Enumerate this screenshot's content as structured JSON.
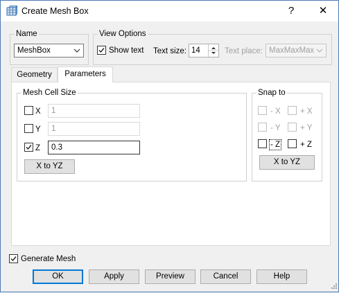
{
  "window": {
    "title": "Create Mesh Box",
    "help_label": "?",
    "close_label": "✕"
  },
  "name_group": {
    "title": "Name",
    "selected": "MeshBox"
  },
  "view_options": {
    "title": "View Options",
    "show_text_label": "Show text",
    "show_text_checked": true,
    "text_size_label": "Text size:",
    "text_size_value": "14",
    "text_place_label": "Text place:",
    "text_place_value": "MaxMaxMax"
  },
  "tabs": [
    {
      "label": "Geometry",
      "active": false
    },
    {
      "label": "Parameters",
      "active": true
    }
  ],
  "mesh_cell_size": {
    "title": "Mesh Cell Size",
    "rows": [
      {
        "label": "X",
        "checked": false,
        "value": "1",
        "enabled": false
      },
      {
        "label": "Y",
        "checked": false,
        "value": "1",
        "enabled": false
      },
      {
        "label": "Z",
        "checked": true,
        "value": "0.3",
        "enabled": true
      }
    ],
    "x_to_yz_label": "X to YZ"
  },
  "snap_to": {
    "title": "Snap to",
    "items": [
      {
        "label": "- X",
        "enabled": false
      },
      {
        "label": "+ X",
        "enabled": false
      },
      {
        "label": "- Y",
        "enabled": false
      },
      {
        "label": "+ Y",
        "enabled": false
      },
      {
        "label": "- Z",
        "enabled": true
      },
      {
        "label": "+ Z",
        "enabled": true
      }
    ],
    "x_to_yz_label": "X to YZ"
  },
  "generate_mesh": {
    "label": "Generate Mesh",
    "checked": true
  },
  "footer": {
    "ok": "OK",
    "apply": "Apply",
    "preview": "Preview",
    "cancel": "Cancel",
    "help": "Help"
  },
  "colors": {
    "accent": "#0078d7",
    "disabled_text": "#a0a0a0",
    "window_border": "#4a7ab5"
  }
}
